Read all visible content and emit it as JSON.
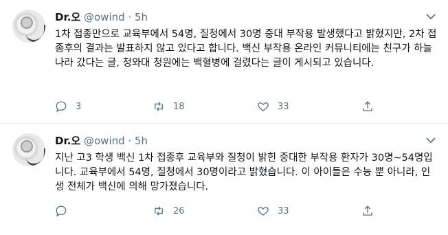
{
  "tweets": [
    {
      "author_name": "Dr.오",
      "handle": "@owind",
      "separator": "·",
      "time": "5h",
      "text": "1차 접종만으로 교육부에서 54명, 질청에서 30명 중대 부작용 발생했다고 밝혔지만, 2차 접종후의 결과는 발표하지 않고 있다고 합니다. 백신 부작용 온라인 커뮤니티에는 친구가 하늘나라 갔다는 글, 청와대 청원에는 백혈병에 걸렸다는 글이 게시되고 있습니다.",
      "reply_count": "3",
      "retweet_count": "18",
      "like_count": "33",
      "share_count": ""
    },
    {
      "author_name": "Dr.오",
      "handle": "@owind",
      "separator": "·",
      "time": "5h",
      "text": "지난 고3 학생 백신 1차 접종후 교육부와 질청이 밝힌 중대한 부작용 환자가 30명~54명입니다. 교육부에서 54명, 질청에서 30명이라고 밝혔습니다. 이 아이들은 수능 뿐 아니라, 인생 전체가 백신에 의해 망가졌습니다.",
      "reply_count": "",
      "retweet_count": "26",
      "like_count": "33",
      "share_count": ""
    }
  ],
  "icons": {
    "reply": "reply-icon",
    "retweet": "retweet-icon",
    "like": "heart-icon",
    "share": "share-icon",
    "more": "chevron-down-icon"
  },
  "colors": {
    "text": "#0f1419",
    "meta": "#5b7083",
    "divider": "#e6ecf0"
  }
}
